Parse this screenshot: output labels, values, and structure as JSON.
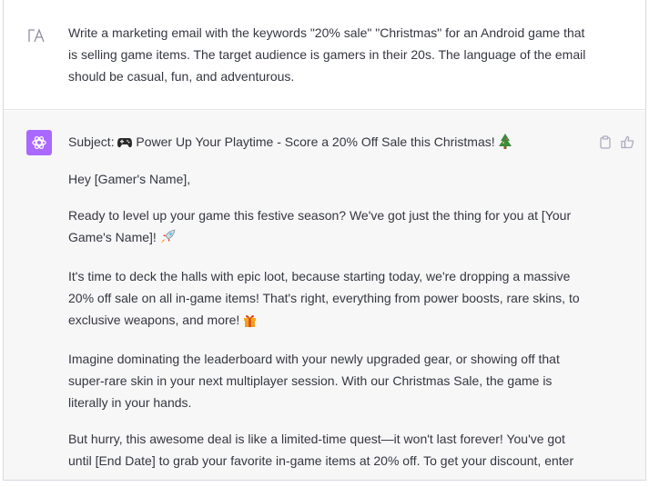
{
  "conversation": {
    "user_message": "Write a marketing email with the keywords \"20% sale\" \"Christmas\" for an Android game that is selling game items. The target audience is gamers in their 20s. The language of the email should be casual, fun, and adventurous.",
    "assistant": {
      "subject_label": "Subject:",
      "subject_text": "Power Up Your Playtime - Score a 20% Off Sale this Christmas!",
      "greeting": "Hey [Gamer's Name],",
      "p1": "Ready to level up your game this festive season? We've got just the thing for you at [Your Game's Name]!",
      "p2": "It's time to deck the halls with epic loot, because starting today, we're dropping a massive 20% off sale on all in-game items! That's right, everything from power boosts, rare skins, to exclusive weapons, and more!",
      "p3": "Imagine dominating the leaderboard with your newly upgraded gear, or showing off that super-rare skin in your next multiplayer session. With our Christmas Sale, the game is literally in your hands.",
      "p4": "But hurry, this awesome deal is like a limited-time quest—it won't last forever! You've got until [End Date] to grab your favorite in-game items at 20% off. To get your discount, enter"
    }
  },
  "icons": {
    "user_avatar": "user-initials-icon",
    "assistant_avatar": "openai-logo-icon",
    "subject_emoji": "game-controller-icon",
    "subject_end_emoji": "christmas-tree-icon",
    "p1_emoji": "rocket-icon",
    "p2_emoji": "gift-icon",
    "copy": "clipboard-icon",
    "like": "thumbs-up-icon"
  },
  "colors": {
    "assistant_bg": "#f7f7f8",
    "avatar_bg": "#ab68ff",
    "text": "#353740",
    "icon_gray": "#acacbe"
  }
}
